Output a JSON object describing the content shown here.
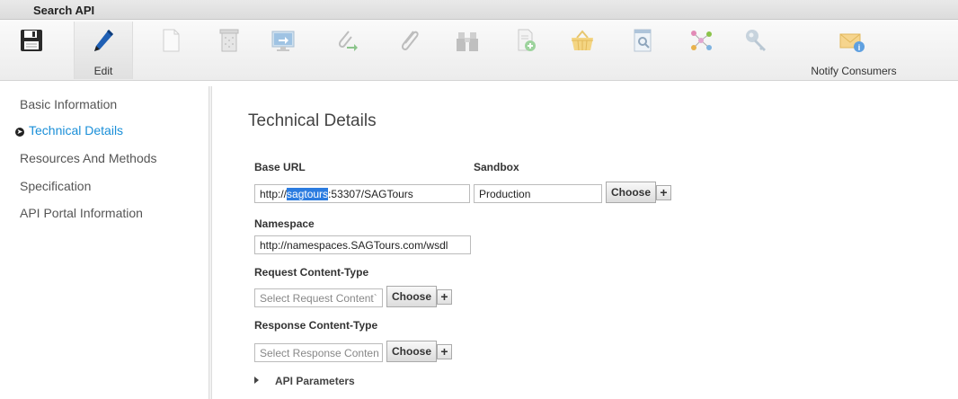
{
  "window": {
    "title": "Search API"
  },
  "toolbar": {
    "edit_label": "Edit",
    "notify_label": "Notify Consumers",
    "icons": [
      "save-icon",
      "edit-pen-icon",
      "document-icon",
      "trash-icon",
      "monitor-icon",
      "attach-arrow-icon",
      "paperclip-icon",
      "binoculars-icon",
      "add-document-icon",
      "basket-icon",
      "search-document-icon",
      "hierarchy-icon",
      "key-icon",
      "notify-envelope-icon"
    ]
  },
  "sidebar": {
    "items": [
      {
        "label": "Basic Information"
      },
      {
        "label": "Technical Details",
        "active": true
      },
      {
        "label": "Resources And Methods"
      },
      {
        "label": "Specification"
      },
      {
        "label": "API Portal Information"
      }
    ]
  },
  "main": {
    "title": "Technical Details",
    "base_url": {
      "label": "Base URL",
      "value_prefix": "http://",
      "value_selected": "sagtours",
      "value_suffix": ":53307/SAGTours"
    },
    "sandbox": {
      "label": "Sandbox",
      "value": "Production",
      "choose": "Choose"
    },
    "namespace": {
      "label": "Namespace",
      "value": "http://namespaces.SAGTours.com/wsdl"
    },
    "request_ct": {
      "label": "Request Content-Type",
      "placeholder": "Select Request Content`",
      "choose": "Choose"
    },
    "response_ct": {
      "label": "Response Content-Type",
      "placeholder": "Select Response Conten",
      "choose": "Choose"
    },
    "api_params": {
      "label": "API Parameters"
    }
  },
  "colors": {
    "accent": "#1a8fd8",
    "selection": "#2b7ce0"
  }
}
